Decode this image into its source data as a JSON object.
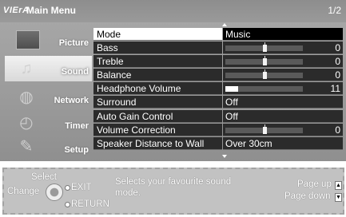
{
  "header": {
    "brand": "VIErA",
    "title": "Main Menu",
    "page": "1/2"
  },
  "sidebar": {
    "items": [
      {
        "label": "Picture",
        "icon": "picture-icon",
        "active": false
      },
      {
        "label": "Sound",
        "icon": "speaker-icon",
        "active": true
      },
      {
        "label": "Network",
        "icon": "globe-icon",
        "active": false
      },
      {
        "label": "Timer",
        "icon": "clock-icon",
        "active": false
      },
      {
        "label": "Setup",
        "icon": "wrench-icon",
        "active": false
      }
    ]
  },
  "settings": [
    {
      "name": "Mode",
      "value": "Music",
      "type": "text",
      "selected": true
    },
    {
      "name": "Bass",
      "value": "0",
      "type": "center-slider",
      "level": 0
    },
    {
      "name": "Treble",
      "value": "0",
      "type": "center-slider",
      "level": 0
    },
    {
      "name": "Balance",
      "value": "0",
      "type": "center-slider",
      "level": 0
    },
    {
      "name": "Headphone Volume",
      "value": "11",
      "type": "fill-slider",
      "level": 0.17
    },
    {
      "name": "Surround",
      "value": "Off",
      "type": "text"
    },
    {
      "name": "Auto Gain Control",
      "value": "Off",
      "type": "text"
    },
    {
      "name": "Volume Correction",
      "value": "0",
      "type": "center-slider",
      "level": 0
    },
    {
      "name": "Speaker Distance to Wall",
      "value": "Over 30cm",
      "type": "text"
    }
  ],
  "footer": {
    "select": "Select",
    "change": "Change",
    "exit": "EXIT",
    "return": "RETURN",
    "help_line1": "Selects your favourite sound",
    "help_line2": "mode.",
    "page_up": "Page up",
    "page_down": "Page down"
  }
}
